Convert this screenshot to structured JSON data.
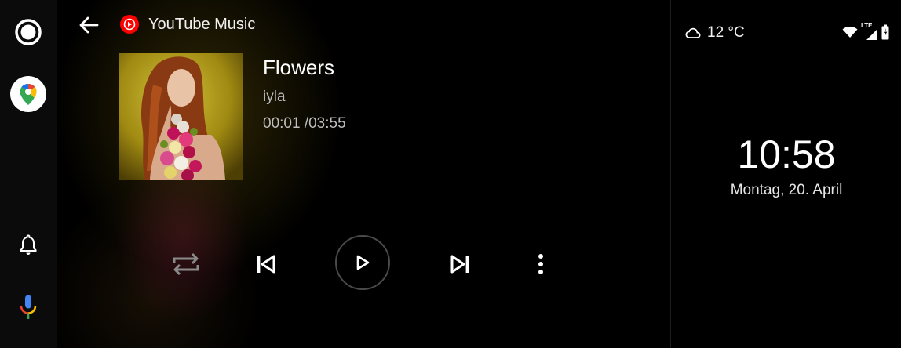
{
  "rail": {
    "items": [
      {
        "name": "launcher",
        "icon": "launcher-circle-icon"
      },
      {
        "name": "maps",
        "icon": "google-maps-icon"
      },
      {
        "name": "notifications",
        "icon": "bell-icon"
      },
      {
        "name": "assistant",
        "icon": "microphone-icon"
      }
    ]
  },
  "header": {
    "app_title": "YouTube Music",
    "app_icon": "youtube-music-icon",
    "back_icon": "arrow-back-icon"
  },
  "track": {
    "title": "Flowers",
    "artist": "iyla",
    "time": "00:01 /03:55"
  },
  "controls": {
    "repeat_icon": "repeat-icon",
    "prev_icon": "skip-previous-icon",
    "play_icon": "play-icon",
    "next_icon": "skip-next-icon",
    "more_icon": "more-vert-icon"
  },
  "status": {
    "weather_icon": "cloud-icon",
    "weather_text": "12 °C",
    "network_label": "LTE",
    "wifi_icon": "wifi-icon",
    "signal_icon": "cell-signal-icon",
    "battery_icon": "battery-icon"
  },
  "clock": {
    "time": "10:58",
    "date": "Montag, 20. April"
  },
  "colors": {
    "youtube_red": "#ff0000",
    "accent_gold": "#c9b52a"
  }
}
